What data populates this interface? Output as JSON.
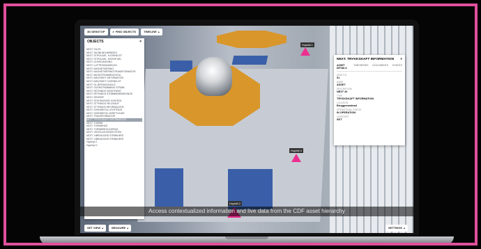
{
  "topbar": {
    "btn1": "3D DESKTOP",
    "btn2": "FIND OBJECTS",
    "btn3": "TIMELINE"
  },
  "objects": {
    "title": "OBJECTS",
    "close": "×",
    "rows": [
      "NEXT. SILOS",
      "NEXT. SKOBLING/ARBEIDS",
      "NEXT. STIPULARL. HJORNELST",
      "NEXT. STIPULARL. RATNIP ARL",
      "NEXT. LEKKEVAGNING",
      "NEXT. LUFTROM/KABELEN",
      "NEXT. MAGNETISERING",
      "NEXT. MAGNETISERING/TRANSFORMATOR",
      "NEXT. MIDDSTROMMENGSTAL",
      "NEXT. MÅLESEKT INFORMATION",
      "NEXT. MÅLESEKT HJORNELST",
      "NEXT. OLJEFRAKSAGALS",
      "NEXT. OVERSTRØMMING STRØM",
      "NEXT. RETNINGS VENSTREDE",
      "NEXT. RETNINGS STRØMBEBSMEDINGE",
      "NEXT. SENSOR",
      "NEXT. STATISK/FASE KONTROL",
      "NEXT. STYRINGS VELDSAUF",
      "NEXT. STYRINGS INFORMASJON",
      "NEXT. SVEISMETAL LEVETRIUS",
      "NEXT. SVEISMETAL SKRIFTLINGE",
      "NEXT. TRANSFORMATOR",
      "NEXT. TRYKKSKAFT INFORMATION",
      "NEXT. TURBIN",
      "NEXT. TURBINHUS",
      "NEXT. TURBINREGULERING",
      "NEXT. VENTILASJONSSYSTEM",
      "NEXT. VIBRASJONS STRØM BRS",
      "NEXT. VIBRASJONS STRØM BRS",
      "Hyprtopl 1",
      "Hyprtopl 2"
    ],
    "selected_index": 22
  },
  "details": {
    "title": "NEXT. TRYKKSKAFT INFORMATION",
    "close": "×",
    "tabs": [
      "ASSET DETAILS",
      "TIMESERIES",
      "DOCUMENTS",
      "EVENTS"
    ],
    "fields": [
      {
        "label": "ASSET ID",
        "value": "51"
      },
      {
        "label": "NAME",
        "value": "ASSET"
      },
      {
        "label": "DESCRIPTION",
        "value": "NEXT 26"
      },
      {
        "label": "TYPE",
        "value": "TRYKKSKAFT INFORMATION"
      },
      {
        "label": "LOCATION",
        "value": "Bruggemastnad"
      },
      {
        "label": "OPERATIONAL STATUS",
        "value": "IN OPERATION"
      },
      {
        "label": "CATEGORY",
        "value": "SKT"
      }
    ]
  },
  "scene_tags": [
    "Hopfall 1",
    "Hopfall 3",
    "Hopfall 2"
  ],
  "caption": "Access contextualized information and live data from the CDF asset hierarchy",
  "bottom": {
    "btn1": "SET VIEW",
    "btn2": "MEASURE"
  },
  "settings": "SETTINGS"
}
